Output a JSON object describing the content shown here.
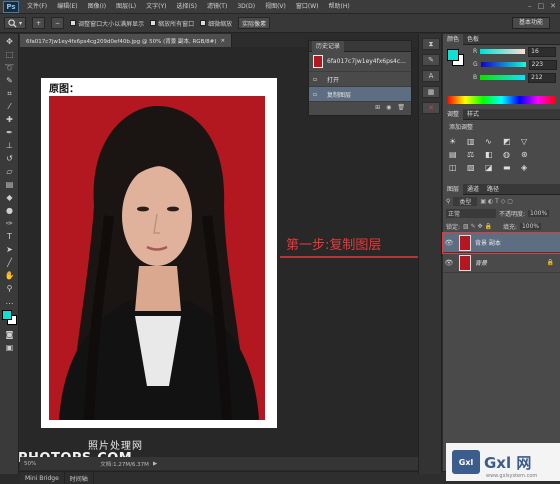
{
  "app": {
    "logo": "Ps"
  },
  "menu": [
    "文件(F)",
    "编辑(E)",
    "图像(I)",
    "图层(L)",
    "文字(Y)",
    "选择(S)",
    "滤镜(T)",
    "3D(D)",
    "视图(V)",
    "窗口(W)",
    "帮助(H)"
  ],
  "options": {
    "zoom_icon": "zoom-icon",
    "check1": "调整窗口大小以满屏显示",
    "check2": "缩放所有窗口",
    "check3": "细微缩放",
    "button": "实际像素",
    "workspace": "基本功能"
  },
  "document": {
    "tab_title": "6fa017c7jw1ey4fx6ps4cg209d0ef40b.jpg @ 50% (背景 副本, RGB/8#)",
    "heading": "原图：",
    "status_zoom": "50%",
    "status_doc": "文档:1.27M/6.37M"
  },
  "watermark": {
    "cn": "照片处理网",
    "en": "PHOTOPS.COM"
  },
  "annotation": "第一步:复制图层",
  "history": {
    "tab": "历史记录",
    "items": [
      "6fa017c7jw1ey4fx6ps4c...",
      "打开",
      "复制图层"
    ],
    "selected": 2
  },
  "color_panel": {
    "tabs": [
      "颜色",
      "色板"
    ],
    "r": "16",
    "g": "223",
    "b": "212",
    "fg": "#10dfd4",
    "bg": "#ffffff"
  },
  "adjustments": {
    "tabs": [
      "调整",
      "样式"
    ],
    "title": "添加调整"
  },
  "layers": {
    "tabs": [
      "图层",
      "通道",
      "路径"
    ],
    "kind": "类型",
    "blend": "正常",
    "opacity_label": "不透明度:",
    "opacity": "100%",
    "lock_label": "锁定:",
    "fill_label": "填充:",
    "fill": "100%",
    "items": [
      {
        "name": "背景 副本",
        "selected": true
      },
      {
        "name": "背景",
        "selected": false
      }
    ]
  },
  "bottom_tabs": [
    "Mini Bridge",
    "时间轴"
  ],
  "gxl": {
    "logo": "Gxl",
    "text": "Gxl 网",
    "url": "www.gxlsystem.com"
  },
  "colors": {
    "accent_red": "#e33b3b",
    "photo_bg": "#b3171f",
    "selection": "#5d6e82"
  }
}
